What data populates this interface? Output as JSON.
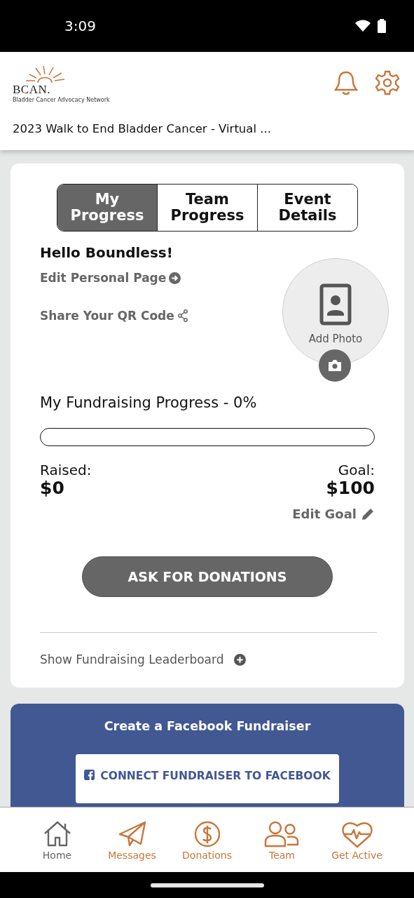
{
  "status_bar": {
    "time": "3:09"
  },
  "header": {
    "logo": {
      "name": "BCAN.",
      "tagline": "Bladder Cancer Advocacy Network"
    },
    "event_title": "2023 Walk to End Bladder Cancer - Virtual ..."
  },
  "tabs": [
    {
      "label": "My Progress",
      "selected": true
    },
    {
      "label": "Team Progress",
      "selected": false
    },
    {
      "label": "Event Details",
      "selected": false
    }
  ],
  "greeting": "Hello Boundless!",
  "links": [
    {
      "kind": "arrow",
      "label": "Edit Personal Page"
    },
    {
      "kind": "share",
      "label": "Share Your QR Code"
    }
  ],
  "photo": {
    "label": "Add Photo"
  },
  "progress": {
    "title": "My Fundraising Progress - 0%",
    "raised_label": "Raised:",
    "raised": "$0",
    "goal_label": "Goal:",
    "goal": "$100",
    "edit_goal": "Edit Goal"
  },
  "ask_button": "ASK FOR DONATIONS",
  "leaderboard_toggle": {
    "label": "Show Fundraising Leaderboard",
    "expanded": false
  },
  "facebook": {
    "title": "Create a Facebook Fundraiser",
    "button": "CONNECT FUNDRAISER TO FACEBOOK"
  },
  "nav": [
    {
      "kind": "home",
      "label": "Home",
      "selected": true
    },
    {
      "kind": "messages",
      "label": "Messages",
      "selected": false
    },
    {
      "kind": "donations",
      "label": "Donations",
      "selected": false
    },
    {
      "kind": "team",
      "label": "Team",
      "selected": false
    },
    {
      "kind": "active",
      "label": "Get Active",
      "selected": false
    }
  ]
}
